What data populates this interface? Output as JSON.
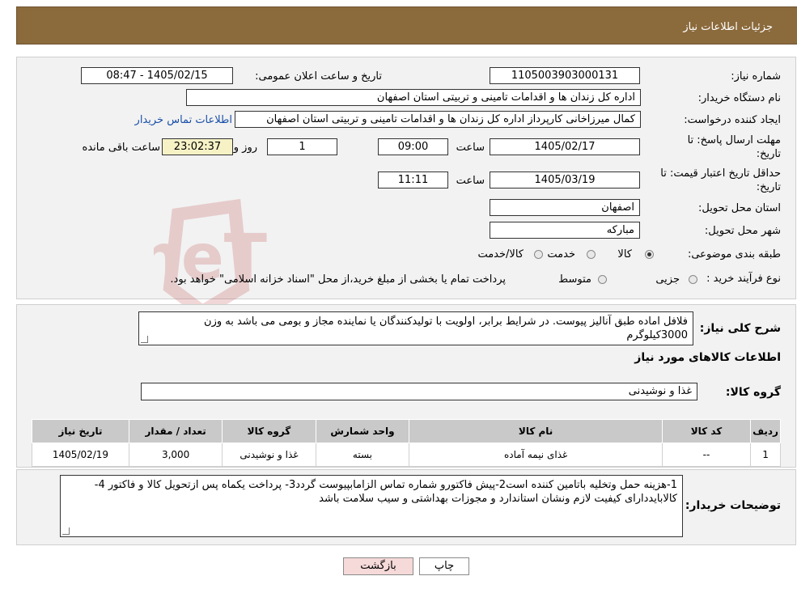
{
  "header": {
    "title": "جزئیات اطلاعات نیاز"
  },
  "form": {
    "need_number_label": "شماره نیاز:",
    "need_number": "1105003903000131",
    "announce_label": "تاریخ و ساعت اعلان عمومی:",
    "announce_value": "1405/02/15 - 08:47",
    "buyer_org_label": "نام دستگاه خریدار:",
    "buyer_org": "اداره کل زندان ها و اقدامات تامینی و تربیتی استان اصفهان",
    "requester_label": "ایجاد کننده درخواست:",
    "requester": "کمال میرزاخانی کارپرداز اداره کل زندان ها و اقدامات تامینی و تربیتی استان اصفهان",
    "contact_link": "اطلاعات تماس خریدار",
    "reply_deadline_label_1": "مهلت ارسال پاسخ: تا",
    "reply_deadline_label_2": "تاریخ:",
    "reply_date": "1405/02/17",
    "time_label": "ساعت",
    "reply_time": "09:00",
    "days_value": "1",
    "days_label": "روز و",
    "remaining_time": "23:02:37",
    "remaining_label": "ساعت باقی مانده",
    "price_valid_label_1": "حداقل تاریخ اعتبار قیمت: تا",
    "price_valid_label_2": "تاریخ:",
    "price_valid_date": "1405/03/19",
    "price_valid_time": "11:11",
    "province_label": "استان محل تحویل:",
    "province": "اصفهان",
    "city_label": "شهر محل تحویل:",
    "city": "مبارکه",
    "category_label": "طبقه بندی موضوعی:",
    "category_options": [
      "کالا",
      "خدمت",
      "کالا/خدمت"
    ],
    "process_label": "نوع فرآیند خرید :",
    "process_options": [
      "جزیی",
      "متوسط"
    ],
    "process_note": "پرداخت تمام یا بخشی از مبلغ خرید،از محل \"اسناد خزانه اسلامی\" خواهد بود."
  },
  "description": {
    "label": "شرح کلی نیاز:",
    "text": "فلافل اماده طبق آنالیز پیوست. در شرایط برابر، اولویت با تولیدکنندگان یا نماینده مجاز و بومی می باشد به وزن 3000کیلوگرم"
  },
  "goods": {
    "section_title": "اطلاعات کالاهای مورد نیاز",
    "group_label": "گروه کالا:",
    "group_value": "غذا و نوشیدنی",
    "columns": [
      "ردیف",
      "کد کالا",
      "نام کالا",
      "واحد شمارش",
      "گروه کالا",
      "تعداد / مقدار",
      "تاریخ نیاز"
    ],
    "rows": [
      [
        "1",
        "--",
        "غذای نیمه آماده",
        "بسته",
        "غذا و نوشیدنی",
        "3,000",
        "1405/02/19"
      ]
    ]
  },
  "buyer_notes": {
    "label": "توضیحات خریدار:",
    "text": "1-هزینه حمل وتخلیه باتامین کننده است2-پیش فاکتورو شماره تماس الزامابپیوست گردد3- پرداخت یکماه پس ازتحویل کالا و فاکتور 4-کالابایددارای کیفیت لازم ونشان استاندارد و مجوزات بهداشتی و سیب سلامت باشد"
  },
  "buttons": {
    "print": "چاپ",
    "back": "بازگشت"
  },
  "watermark_text": "AriaTender.neT",
  "colors": {
    "header": "#8b6a3c",
    "link": "#1a4fa8",
    "back_button": "#f6d9d9",
    "print_button": "#ffffff"
  }
}
